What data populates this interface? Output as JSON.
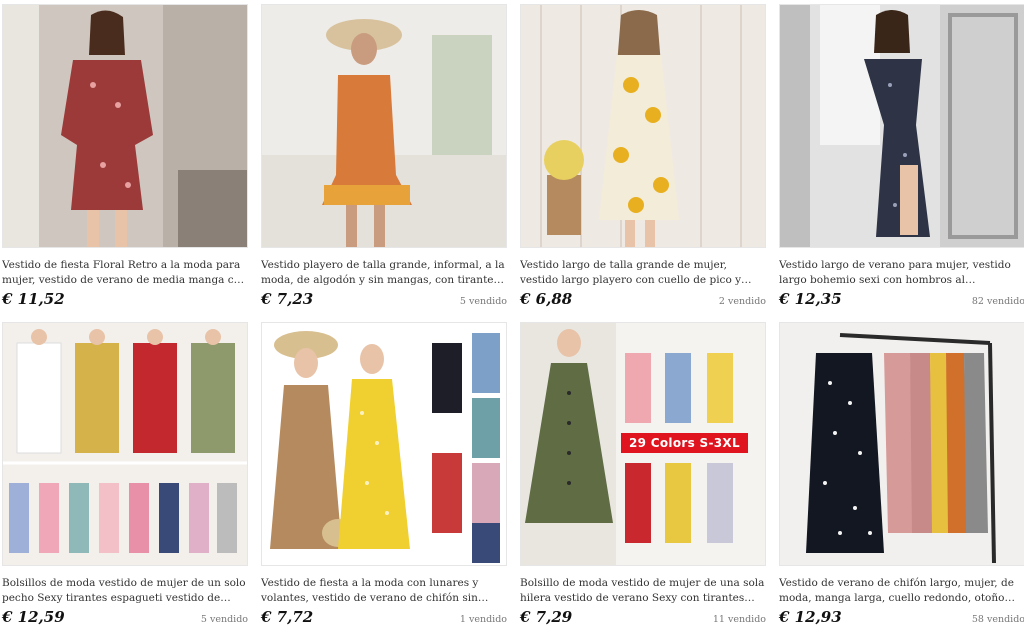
{
  "products": [
    {
      "title": "Vestido de fiesta Floral Retro a la moda para mujer, vestido de verano de media manga con cuello en V,…",
      "price": "€ 11,52",
      "sold": "",
      "image": "woman-floral-dress-photo"
    },
    {
      "title": "Vestido playero de talla grande, informal, a la moda, de algodón y sin mangas, con tirantes finos, cuello e…",
      "price": "€ 7,23",
      "sold": "5 vendido",
      "image": "woman-sun-hat-boho-dress-photo"
    },
    {
      "title": "Vestido largo de talla grande de mujer, vestido largo playero con cuello de pico y tirantes finos, vestido…",
      "price": "€ 6,88",
      "sold": "2 vendido",
      "image": "woman-sunflower-dress-photo"
    },
    {
      "title": "Vestido largo de verano para mujer, vestido largo bohemio sexi con hombros al descubierto, cuello de…",
      "price": "€ 12,35",
      "sold": "82 vendido",
      "image": "woman-off-shoulder-dress-photo"
    },
    {
      "title": "Bolsillos de moda vestido de mujer de un solo pecho Sexy tirantes espagueti vestido de verano sin espald…",
      "price": "€ 12,59",
      "sold": "5 vendido",
      "image": "button-dress-color-variants-photo"
    },
    {
      "title": "Vestido de fiesta a la moda con lunares y volantes, vestido de verano de chifón sin mangas con cuello…",
      "price": "€ 7,72",
      "sold": "1 vendido",
      "image": "polka-dot-dress-models-photo"
    },
    {
      "title": "Bolsillo de moda vestido de mujer de una sola hilera vestido de verano Sexy con tirantes finos sin espalda…",
      "price": "€ 7,29",
      "sold": "11 vendido",
      "image": "button-dress-29-colors-photo",
      "badge": "29 Colors   S-3XL"
    },
    {
      "title": "Vestido de verano de chifón largo, mujer, de moda, manga larga, cuello redondo, otoño Primavera, fiesta…",
      "price": "€ 12,93",
      "sold": "58 vendido",
      "image": "dresses-on-rack-photo"
    }
  ],
  "colors": {
    "badge": "#e0141e",
    "price": "#111111",
    "sold": "#777777"
  }
}
